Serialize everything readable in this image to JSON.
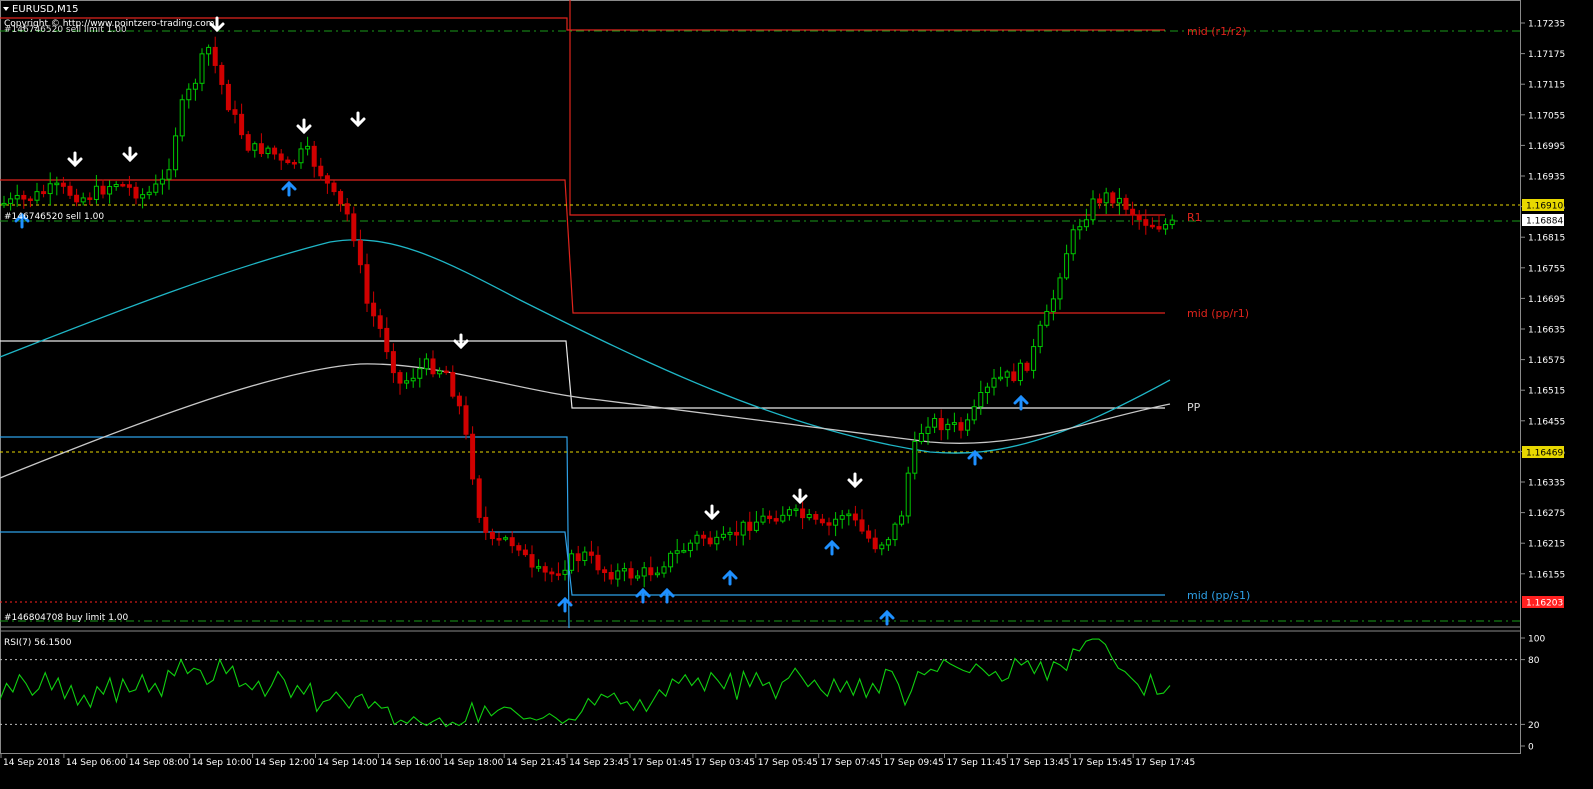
{
  "window": {
    "symbol_title": "EURUSD,M15",
    "copyright": "Copyright © http://www.pointzero-trading.com"
  },
  "colors": {
    "background": "#000000",
    "bull": "#00c800",
    "bear": "#d00000",
    "frame": "#8a8a8a",
    "pivot_red": "#e0241c",
    "pivot_blue": "#2ea0e6",
    "pivot_white": "#e8e8e8",
    "ma_fast": "#1fb6c6",
    "ma_slow": "#c8c8c8",
    "rsi": "#10d010",
    "level_green": "#1a9a1a",
    "level_yellow": "#e8d800",
    "level_red": "#ff2020",
    "sell_arrow": "#ffffff",
    "buy_arrow": "#1e90ff"
  },
  "price_axis": {
    "ticks": [
      "1.17235",
      "1.17175",
      "1.17115",
      "1.17055",
      "1.16995",
      "1.16935",
      "1.16875",
      "1.16815",
      "1.16755",
      "1.16695",
      "1.16635",
      "1.16575",
      "1.16515",
      "1.16455",
      "1.16395",
      "1.16335",
      "1.16275",
      "1.16215",
      "1.16155"
    ],
    "highlight_labels": [
      {
        "text": "1.16910",
        "bg": "#e8d800",
        "fg": "#000000"
      },
      {
        "text": "1.16884",
        "bg": "#ffffff",
        "fg": "#000000"
      },
      {
        "text": "1.16469",
        "bg": "#e8d800",
        "fg": "#000000"
      },
      {
        "text": "1.16203",
        "bg": "#ff2020",
        "fg": "#ffffff"
      }
    ]
  },
  "time_axis": {
    "labels": [
      "14 Sep 2018",
      "14 Sep 06:00",
      "14 Sep 08:00",
      "14 Sep 10:00",
      "14 Sep 12:00",
      "14 Sep 14:00",
      "14 Sep 16:00",
      "14 Sep 18:00",
      "14 Sep 21:45",
      "14 Sep 23:45",
      "17 Sep 01:45",
      "17 Sep 03:45",
      "17 Sep 05:45",
      "17 Sep 07:45",
      "17 Sep 09:45",
      "17 Sep 11:45",
      "17 Sep 13:45",
      "17 Sep 15:45",
      "17 Sep 17:45"
    ]
  },
  "order_labels": {
    "sell": "#146746520 sell 1.00",
    "sell_tp": "#146746520 sell limit 1.00",
    "buy_limit": "#146804708 buy limit 1.00"
  },
  "pivot_labels": {
    "mid_r1_r2": "mid (r1/r2)",
    "r1": "R1",
    "mid_pp_r1": "mid (pp/r1)",
    "pp": "PP",
    "mid_pp_s1": "mid (pp/s1)"
  },
  "rsi": {
    "label": "RSI(7) 56.1500",
    "scale": [
      "100",
      "80",
      "20",
      "0"
    ],
    "values": [
      43,
      58,
      50,
      66,
      58,
      47,
      53,
      68,
      52,
      63,
      44,
      56,
      38,
      47,
      36,
      55,
      48,
      63,
      41,
      62,
      50,
      52,
      66,
      50,
      58,
      46,
      70,
      65,
      80,
      67,
      72,
      70,
      57,
      61,
      80,
      67,
      74,
      55,
      58,
      52,
      60,
      46,
      56,
      69,
      61,
      45,
      56,
      48,
      58,
      32,
      41,
      43,
      50,
      43,
      35,
      45,
      48,
      35,
      41,
      35,
      36,
      20,
      24,
      21,
      27,
      22,
      19,
      23,
      26,
      18,
      22,
      19,
      23,
      40,
      22,
      37,
      28,
      33,
      36,
      35,
      30,
      25,
      26,
      24,
      26,
      30,
      26,
      21,
      25,
      24,
      32,
      44,
      38,
      48,
      45,
      49,
      39,
      41,
      33,
      43,
      32,
      42,
      52,
      46,
      62,
      58,
      66,
      56,
      63,
      51,
      68,
      61,
      53,
      67,
      43,
      69,
      55,
      68,
      56,
      59,
      44,
      59,
      63,
      72,
      64,
      55,
      61,
      52,
      46,
      62,
      50,
      60,
      47,
      62,
      45,
      58,
      49,
      71,
      69,
      57,
      38,
      51,
      69,
      66,
      71,
      69,
      80,
      76,
      73,
      70,
      68,
      76,
      71,
      65,
      69,
      60,
      63,
      81,
      75,
      79,
      67,
      78,
      61,
      78,
      75,
      70,
      90,
      88,
      97,
      99,
      99,
      94,
      82,
      72,
      69,
      63,
      57,
      47,
      66,
      48,
      49,
      56
    ]
  }
}
